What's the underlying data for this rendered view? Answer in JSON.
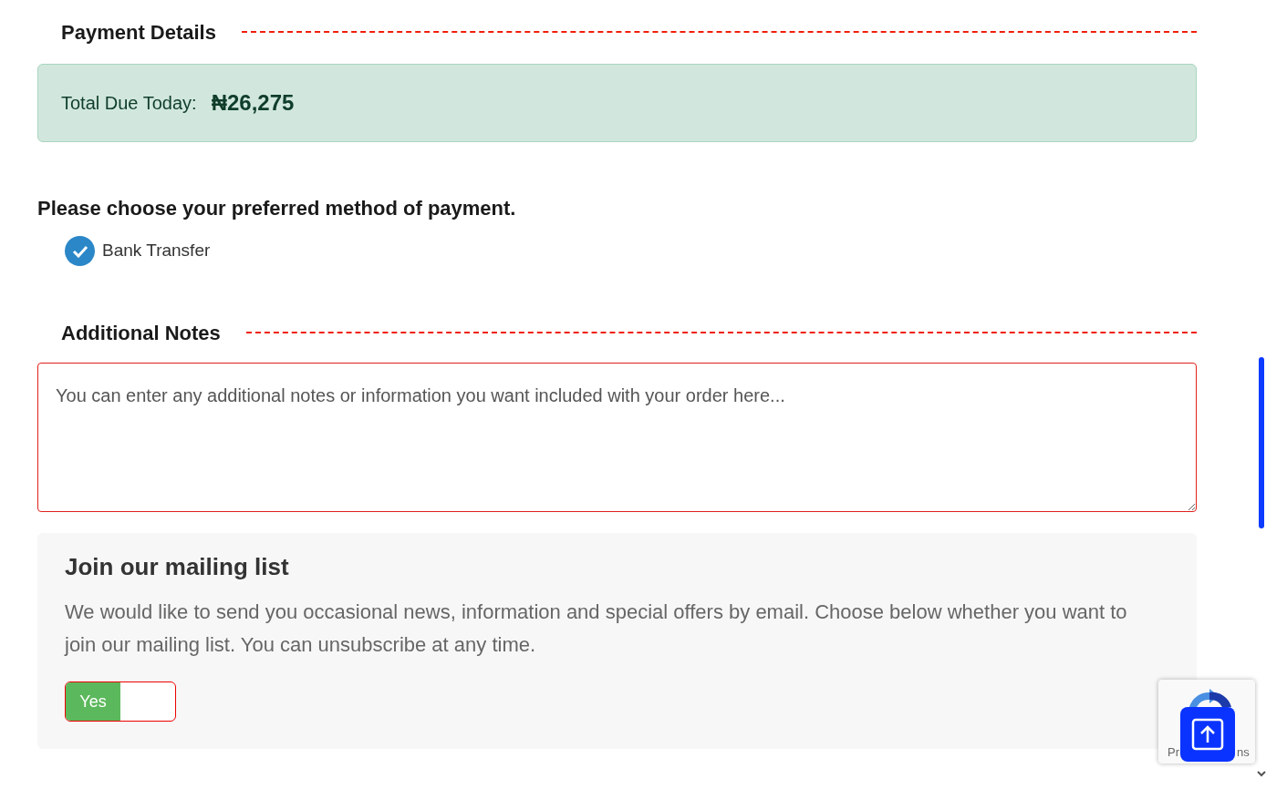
{
  "payment_section": {
    "title": "Payment Details",
    "total_label": "Total Due Today:",
    "total_value": "₦26,275",
    "question": "Please choose your preferred method of payment.",
    "methods": [
      {
        "label": "Bank Transfer",
        "selected": true
      }
    ]
  },
  "notes_section": {
    "title": "Additional Notes",
    "placeholder": "You can enter any additional notes or information you want included with your order here..."
  },
  "mailing_list": {
    "title": "Join our mailing list",
    "description": "We would like to send you occasional news, information and special offers by email. Choose below whether you want to join our mailing list. You can unsubscribe at any time.",
    "toggle": {
      "label": "Yes",
      "on": true
    }
  },
  "recaptcha": {
    "text_left": "Pr",
    "text_right": "ns"
  }
}
